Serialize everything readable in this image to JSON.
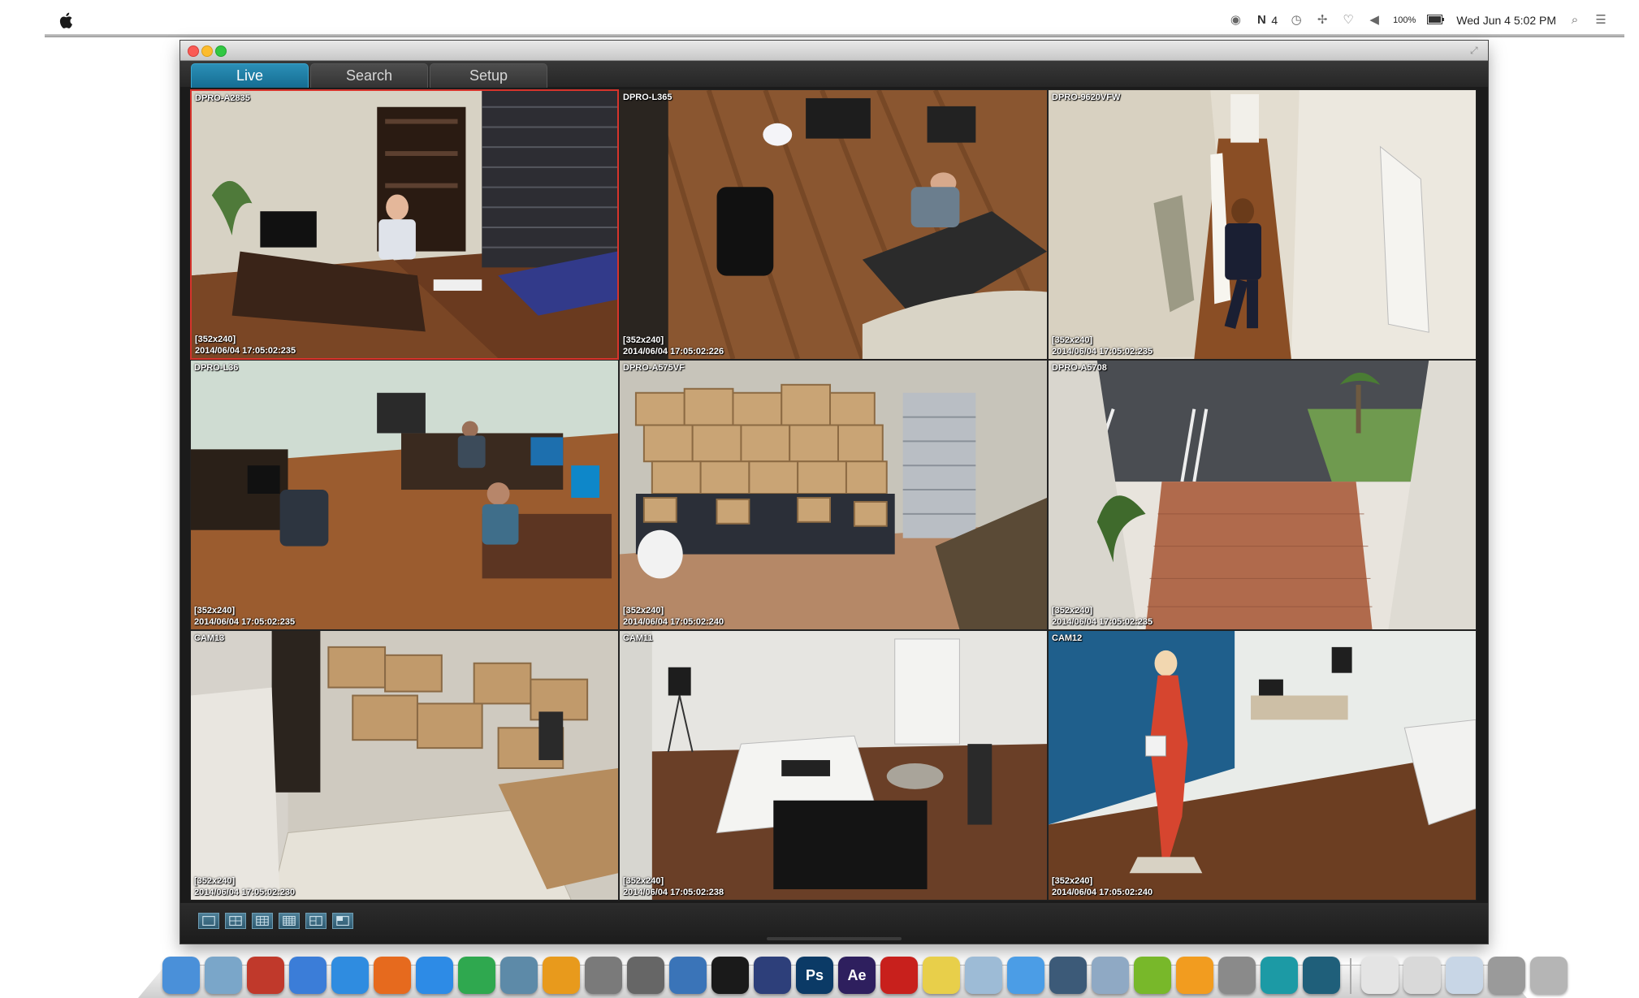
{
  "menubar": {
    "status_items": [
      {
        "name": "camera-icon",
        "text": ""
      },
      {
        "name": "battery-count-icon",
        "text": "4"
      },
      {
        "name": "time-machine-icon",
        "text": ""
      },
      {
        "name": "bluetooth-icon",
        "text": ""
      },
      {
        "name": "wifi-icon",
        "text": ""
      },
      {
        "name": "volume-icon",
        "text": ""
      }
    ],
    "battery_percent": "100%",
    "datetime": "Wed Jun 4  5:02 PM"
  },
  "window": {
    "tabs": [
      {
        "label": "Live",
        "active": true
      },
      {
        "label": "Search",
        "active": false
      },
      {
        "label": "Setup",
        "active": false
      }
    ]
  },
  "cameras": [
    {
      "name": "DPRO-A2835",
      "resolution": "[352x240]",
      "timestamp": "2014/06/04 17:05:02:235",
      "selected": true
    },
    {
      "name": "DPRO-L365",
      "resolution": "[352x240]",
      "timestamp": "2014/06/04 17:05:02:226",
      "selected": false
    },
    {
      "name": "DPRO-9620VFW",
      "resolution": "[352x240]",
      "timestamp": "2014/06/04 17:05:02:235",
      "selected": false
    },
    {
      "name": "DPRO-L36",
      "resolution": "[352x240]",
      "timestamp": "2014/06/04 17:05:02:235",
      "selected": false
    },
    {
      "name": "DPRO-A575VF",
      "resolution": "[352x240]",
      "timestamp": "2014/06/04 17:05:02:240",
      "selected": false
    },
    {
      "name": "DPRO-A5708",
      "resolution": "[352x240]",
      "timestamp": "2014/06/04 17:05:02:235",
      "selected": false
    },
    {
      "name": "CAM13",
      "resolution": "[352x240]",
      "timestamp": "2014/06/04 17:05:02:230",
      "selected": false
    },
    {
      "name": "CAM11",
      "resolution": "[352x240]",
      "timestamp": "2014/06/04 17:05:02:238",
      "selected": false
    },
    {
      "name": "CAM12",
      "resolution": "[352x240]",
      "timestamp": "2014/06/04 17:05:02:240",
      "selected": false
    }
  ],
  "layout_buttons": [
    {
      "name": "layout-1x1-button"
    },
    {
      "name": "layout-2x2-button"
    },
    {
      "name": "layout-3x3-button"
    },
    {
      "name": "layout-4x4-button"
    },
    {
      "name": "layout-5x5-button"
    },
    {
      "name": "layout-6x6-button"
    }
  ],
  "dock": {
    "apps": [
      {
        "name": "finder-icon",
        "label": "",
        "color": "#4a90d9"
      },
      {
        "name": "preview-icon",
        "label": "",
        "color": "#7aa6c9"
      },
      {
        "name": "photo-booth-icon",
        "label": "",
        "color": "#c0392b"
      },
      {
        "name": "itunes-icon",
        "label": "",
        "color": "#3b7dd8"
      },
      {
        "name": "app-store-icon",
        "label": "",
        "color": "#2f8ce0"
      },
      {
        "name": "firefox-icon",
        "label": "",
        "color": "#e66a1e"
      },
      {
        "name": "safari-icon",
        "label": "",
        "color": "#2d8be6"
      },
      {
        "name": "chrome-icon",
        "label": "",
        "color": "#2fa84f"
      },
      {
        "name": "iphoto-icon",
        "label": "",
        "color": "#5d8aa8"
      },
      {
        "name": "picture-app-icon",
        "label": "",
        "color": "#e89a1c"
      },
      {
        "name": "rocket-icon",
        "label": "",
        "color": "#7a7a7a"
      },
      {
        "name": "system-info-icon",
        "label": "",
        "color": "#666666"
      },
      {
        "name": "xcode-icon",
        "label": "",
        "color": "#3a74b8"
      },
      {
        "name": "terminal-icon",
        "label": "",
        "color": "#1a1a1a"
      },
      {
        "name": "indesign-icon",
        "label": "",
        "color": "#2d3f7a"
      },
      {
        "name": "photoshop-icon",
        "label": "Ps",
        "color": "#0b3a66"
      },
      {
        "name": "after-effects-icon",
        "label": "Ae",
        "color": "#2e1f5e"
      },
      {
        "name": "acrobat-icon",
        "label": "",
        "color": "#c8201c"
      },
      {
        "name": "stickies-icon",
        "label": "",
        "color": "#e8cf4a"
      },
      {
        "name": "preview-doc-icon",
        "label": "",
        "color": "#9dbbd6"
      },
      {
        "name": "messages-icon",
        "label": "",
        "color": "#4b9de6"
      },
      {
        "name": "camera-app-icon",
        "label": "",
        "color": "#3c5a78"
      },
      {
        "name": "sharing-icon",
        "label": "",
        "color": "#8fa9c4"
      },
      {
        "name": "brackets-icon",
        "label": "",
        "color": "#78b82a"
      },
      {
        "name": "ibooks-icon",
        "label": "",
        "color": "#f29c1f"
      },
      {
        "name": "disk-utility-icon",
        "label": "",
        "color": "#8a8a8a"
      },
      {
        "name": "arduino-icon",
        "label": "",
        "color": "#1c9aa5"
      },
      {
        "name": "dvr-viewer-icon",
        "label": "",
        "color": "#1f5f7a"
      }
    ],
    "right_items": [
      {
        "name": "document-icon",
        "label": "",
        "color": "#e4e4e4"
      },
      {
        "name": "calendar-grid-icon",
        "label": "",
        "color": "#d9d9d9"
      },
      {
        "name": "mail-doc-icon",
        "label": "",
        "color": "#c8d6e6"
      },
      {
        "name": "screenshot-stack-icon",
        "label": "",
        "color": "#9a9a9a"
      },
      {
        "name": "trash-icon",
        "label": "",
        "color": "#b5b5b5"
      }
    ]
  }
}
